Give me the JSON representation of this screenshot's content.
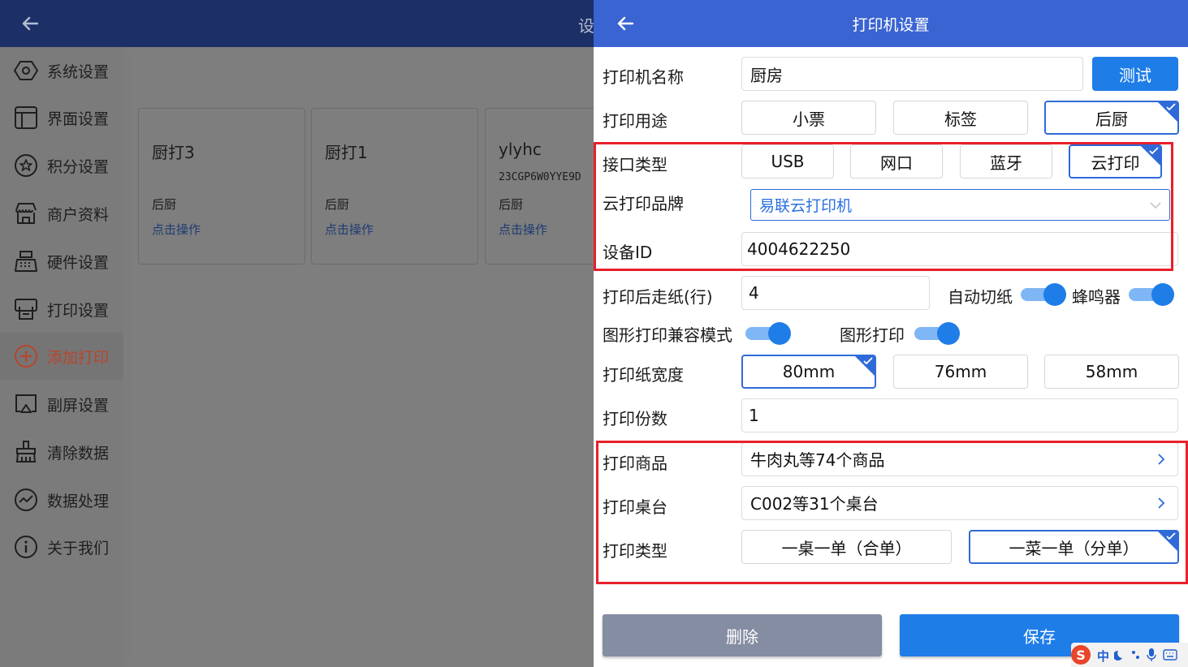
{
  "background": {
    "title": "设",
    "sidebar": [
      {
        "label": "系统设置",
        "icon": "hexagon-settings-icon"
      },
      {
        "label": "界面设置",
        "icon": "layout-icon"
      },
      {
        "label": "积分设置",
        "icon": "star-circle-icon"
      },
      {
        "label": "商户资料",
        "icon": "store-icon"
      },
      {
        "label": "硬件设置",
        "icon": "cash-register-icon"
      },
      {
        "label": "打印设置",
        "icon": "printer-icon"
      },
      {
        "label": "添加打印",
        "icon": "plus-circle-icon",
        "active": true
      },
      {
        "label": "副屏设置",
        "icon": "screen-cast-icon"
      },
      {
        "label": "清除数据",
        "icon": "broom-icon"
      },
      {
        "label": "数据处理",
        "icon": "chart-circle-icon"
      },
      {
        "label": "关于我们",
        "icon": "info-icon"
      }
    ],
    "cards": [
      {
        "name": "厨打3",
        "sub": "",
        "type": "后厨",
        "action": "点击操作"
      },
      {
        "name": "厨打1",
        "sub": "",
        "type": "后厨",
        "action": "点击操作"
      },
      {
        "name": "ylyhc",
        "sub": "23CGP6W0YYE9D",
        "type": "后厨",
        "action": "点击操作"
      }
    ]
  },
  "dialog": {
    "title": "打印机设置",
    "printer_name": {
      "label": "打印机名称",
      "value": "厨房",
      "test_button": "测试"
    },
    "usage": {
      "label": "打印用途",
      "options": [
        "小票",
        "标签",
        "后厨"
      ],
      "selected": "后厨"
    },
    "interface": {
      "label": "接口类型",
      "options": [
        "USB",
        "网口",
        "蓝牙",
        "云打印"
      ],
      "selected": "云打印"
    },
    "cloud_brand": {
      "label": "云打印品牌",
      "value": "易联云打印机"
    },
    "device_id": {
      "label": "设备ID",
      "value": "4004622250"
    },
    "feed_lines": {
      "label": "打印后走纸(行)",
      "value": "4"
    },
    "auto_cut": {
      "label": "自动切纸",
      "on": true
    },
    "buzzer": {
      "label": "蜂鸣器",
      "on": true
    },
    "graphic_compat": {
      "label": "图形打印兼容模式",
      "on": true
    },
    "graphic_print": {
      "label": "图形打印",
      "on": true
    },
    "paper_width": {
      "label": "打印纸宽度",
      "options": [
        "80mm",
        "76mm",
        "58mm"
      ],
      "selected": "80mm"
    },
    "copies": {
      "label": "打印份数",
      "value": "1"
    },
    "products": {
      "label": "打印商品",
      "value": "牛肉丸等74个商品"
    },
    "tables": {
      "label": "打印桌台",
      "value": "C002等31个桌台"
    },
    "print_type": {
      "label": "打印类型",
      "options": [
        "一桌一单（合单）",
        "一菜一单（分单）"
      ],
      "selected": "一菜一单（分单）"
    },
    "delete_button": "删除",
    "save_button": "保存"
  },
  "ime": {
    "logo": "S",
    "mode": "中"
  },
  "colors": {
    "header": "#3a64d1",
    "primary": "#1f7de8",
    "highlight_box": "#e8202a",
    "delete": "#858da3"
  }
}
